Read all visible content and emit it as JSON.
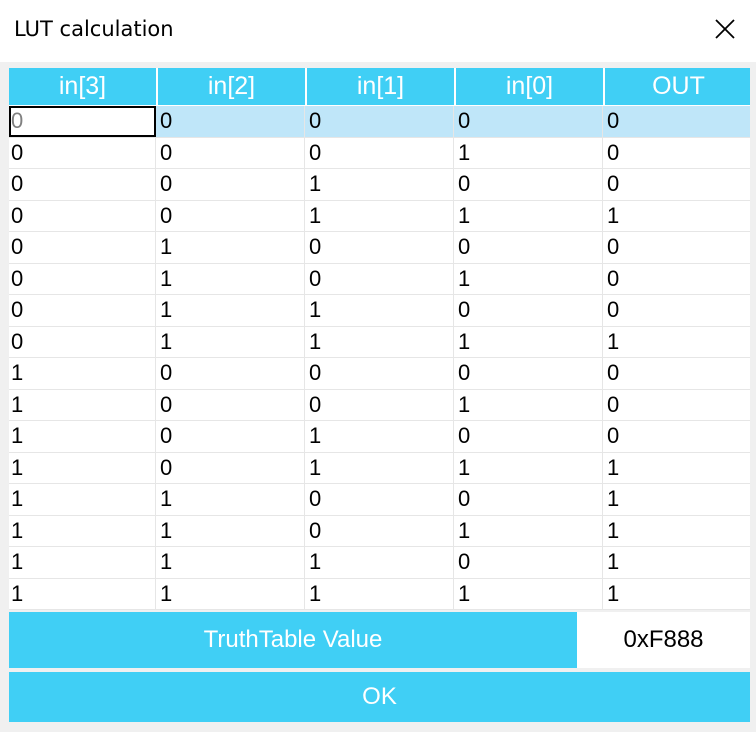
{
  "window": {
    "title": "LUT calculation"
  },
  "table": {
    "headers": [
      "in[3]",
      "in[2]",
      "in[1]",
      "in[0]",
      "OUT"
    ],
    "rows": [
      [
        "0",
        "0",
        "0",
        "0",
        "0"
      ],
      [
        "0",
        "0",
        "0",
        "1",
        "0"
      ],
      [
        "0",
        "0",
        "1",
        "0",
        "0"
      ],
      [
        "0",
        "0",
        "1",
        "1",
        "1"
      ],
      [
        "0",
        "1",
        "0",
        "0",
        "0"
      ],
      [
        "0",
        "1",
        "0",
        "1",
        "0"
      ],
      [
        "0",
        "1",
        "1",
        "0",
        "0"
      ],
      [
        "0",
        "1",
        "1",
        "1",
        "1"
      ],
      [
        "1",
        "0",
        "0",
        "0",
        "0"
      ],
      [
        "1",
        "0",
        "0",
        "1",
        "0"
      ],
      [
        "1",
        "0",
        "1",
        "0",
        "0"
      ],
      [
        "1",
        "0",
        "1",
        "1",
        "1"
      ],
      [
        "1",
        "1",
        "0",
        "0",
        "1"
      ],
      [
        "1",
        "1",
        "0",
        "1",
        "1"
      ],
      [
        "1",
        "1",
        "1",
        "0",
        "1"
      ],
      [
        "1",
        "1",
        "1",
        "1",
        "1"
      ]
    ],
    "selected_row": 0,
    "editing_cell": [
      0,
      0
    ]
  },
  "truth_table": {
    "label": "TruthTable Value",
    "value": "0xF888"
  },
  "ok_button": {
    "label": "OK"
  },
  "colors": {
    "accent": "#40cff5",
    "selection": "#bfe6f9",
    "background": "#f0f0f0"
  },
  "icons": {
    "close": "close-icon"
  }
}
